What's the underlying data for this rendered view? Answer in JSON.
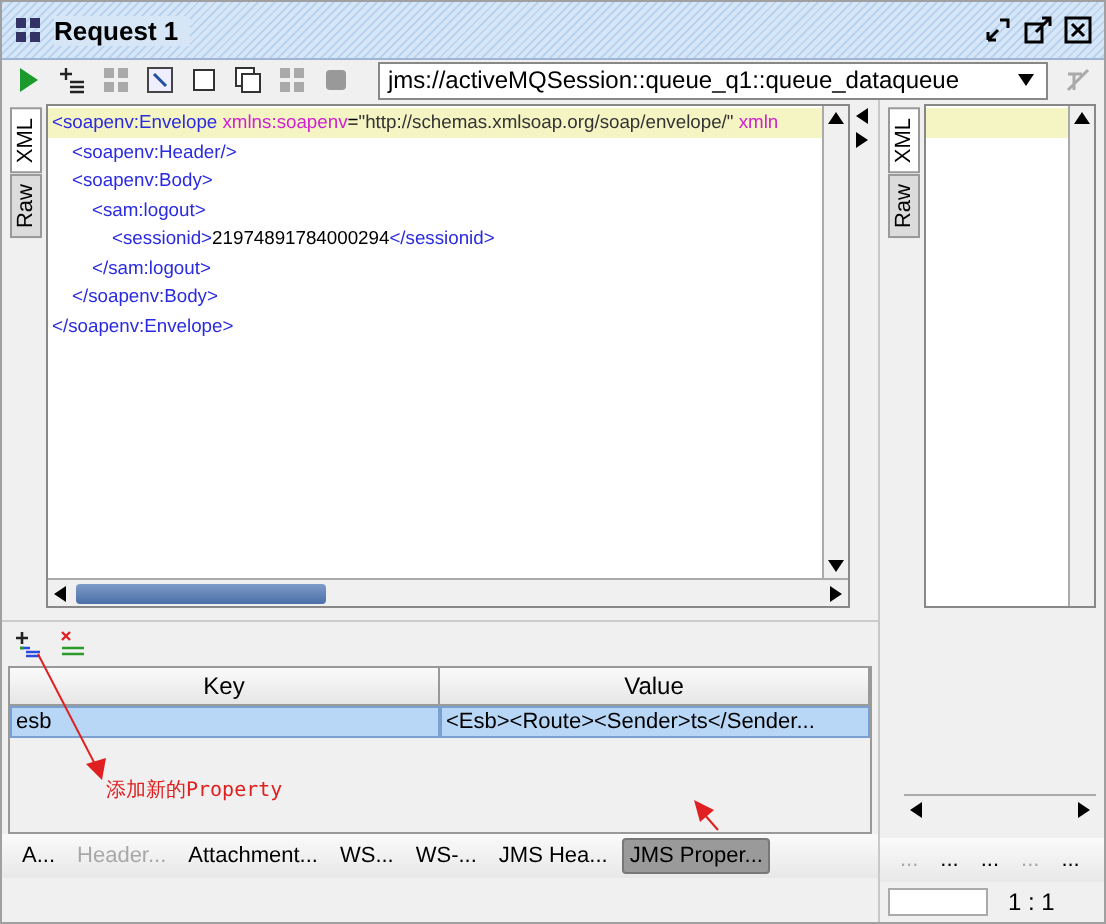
{
  "window": {
    "title": "Request 1"
  },
  "toolbar": {
    "endpoint": "jms://activeMQSession::queue_q1::queue_dataqueue"
  },
  "editor_tabs": [
    {
      "label": "XML",
      "selected": true
    },
    {
      "label": "Raw",
      "selected": false
    }
  ],
  "xml": [
    {
      "parts": [
        {
          "kind": "tag",
          "text": "<soapenv:Envelope"
        },
        {
          "kind": "attr",
          "text": " xmlns:soapenv"
        },
        {
          "kind": "text",
          "text": "="
        },
        {
          "kind": "value",
          "text": "\"http://schemas.xmlsoap.org/soap/envelope/\""
        },
        {
          "kind": "attr",
          "text": " xmln"
        }
      ],
      "children": [
        {
          "parts": [
            {
              "kind": "tag",
              "text": "<soapenv:Header/>"
            }
          ]
        },
        {
          "parts": [
            {
              "kind": "tag",
              "text": "<soapenv:Body>"
            }
          ],
          "children": [
            {
              "parts": [
                {
                  "kind": "tag",
                  "text": "<sam:logout>"
                }
              ],
              "children": [
                {
                  "parts": [
                    {
                      "kind": "tag",
                      "text": "<sessionid>"
                    },
                    {
                      "kind": "text",
                      "text": "21974891784000294"
                    },
                    {
                      "kind": "tag",
                      "text": "</sessionid>"
                    }
                  ]
                }
              ],
              "close": [
                {
                  "kind": "tag",
                  "text": "</sam:logout>"
                }
              ]
            }
          ],
          "close": [
            {
              "kind": "tag",
              "text": "</soapenv:Body>"
            }
          ]
        }
      ],
      "close": [
        {
          "kind": "tag",
          "text": "</soapenv:Envelope>"
        }
      ]
    }
  ],
  "response_tabs": [
    {
      "label": "XML",
      "selected": true
    },
    {
      "label": "Raw",
      "selected": false
    }
  ],
  "properties": {
    "columns": [
      "Key",
      "Value"
    ],
    "rows": [
      {
        "cells": [
          "esb",
          "<Esb><Route><Sender>ts</Sender..."
        ],
        "selected": true
      }
    ]
  },
  "annotation": {
    "text": "添加新的Property"
  },
  "bottom_tabs": [
    {
      "label": "A...",
      "selected": false,
      "disabled": false
    },
    {
      "label": "Header...",
      "selected": false,
      "disabled": true
    },
    {
      "label": "Attachment...",
      "selected": false,
      "disabled": false
    },
    {
      "label": "WS...",
      "selected": false,
      "disabled": false
    },
    {
      "label": "WS-...",
      "selected": false,
      "disabled": false
    },
    {
      "label": "JMS Hea...",
      "selected": false,
      "disabled": false
    },
    {
      "label": "JMS Proper...",
      "selected": true,
      "disabled": false
    }
  ],
  "response_bottom_tabs": [
    {
      "label": "...",
      "disabled": true
    },
    {
      "label": "...",
      "disabled": false
    },
    {
      "label": "...",
      "disabled": false
    },
    {
      "label": "...",
      "disabled": true
    },
    {
      "label": "...",
      "disabled": false
    }
  ],
  "status_bar": {
    "position": "1 : 1"
  }
}
